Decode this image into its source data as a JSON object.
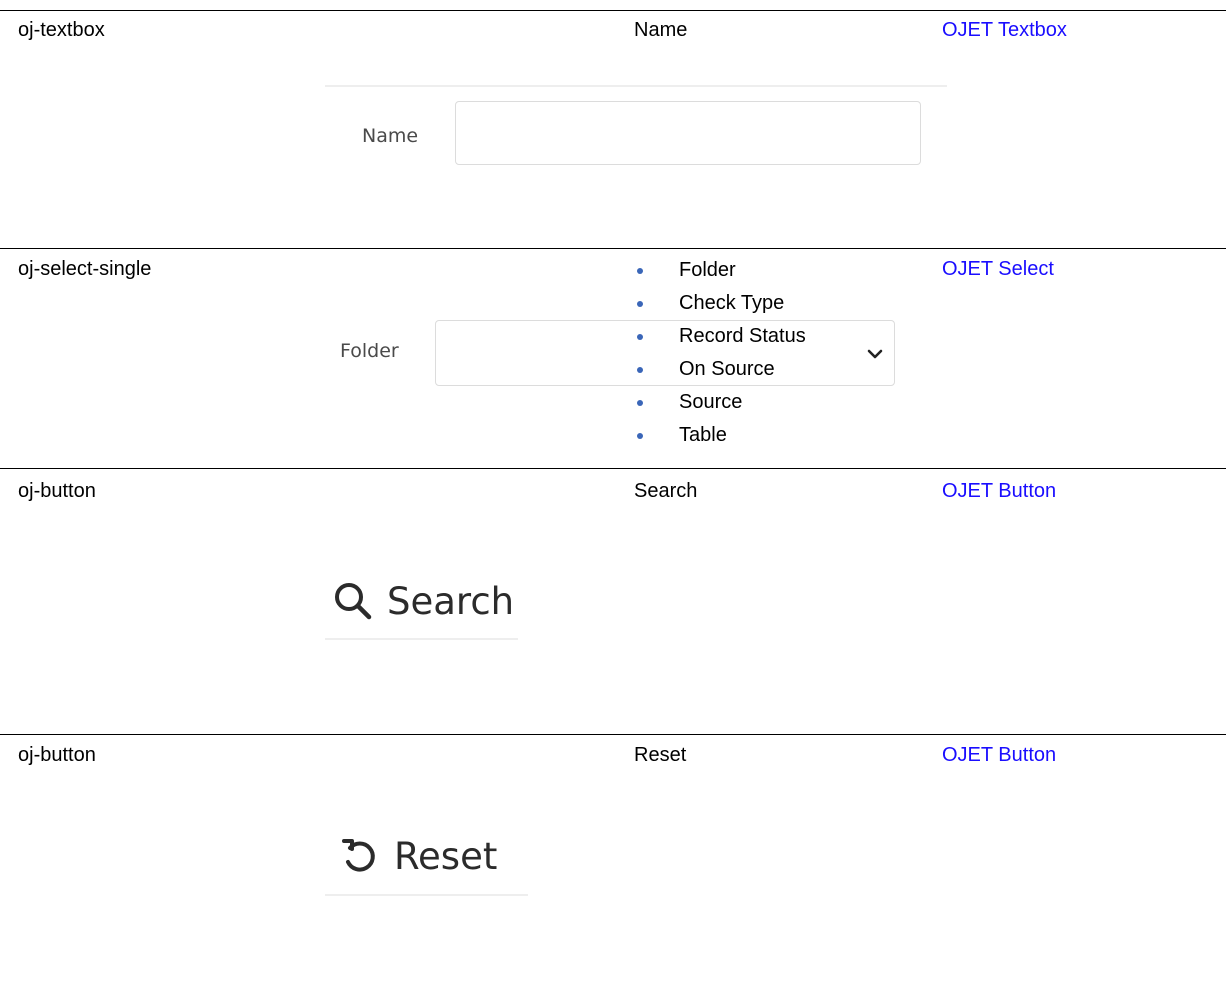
{
  "rows": [
    {
      "component": "oj-textbox",
      "description": "Name",
      "link": "OJET Textbox",
      "screenshot": {
        "label": "Name",
        "value": ""
      }
    },
    {
      "component": "oj-select-single",
      "options": [
        "Folder",
        "Check Type",
        "Record Status",
        "On Source",
        "Source",
        "Table"
      ],
      "link": "OJET Select",
      "screenshot": {
        "label": "Folder",
        "value": ""
      }
    },
    {
      "component": "oj-button",
      "description": "Search",
      "link": "OJET Button",
      "screenshot": {
        "label": "Search",
        "icon": "search-icon"
      }
    },
    {
      "component": "oj-button",
      "description": "Reset",
      "link": "OJET Button",
      "screenshot": {
        "label": "Reset",
        "icon": "reset-icon"
      }
    }
  ],
  "colors": {
    "link": "#1a0dff",
    "bullet": "#3a66b8",
    "rule": "#000000"
  }
}
